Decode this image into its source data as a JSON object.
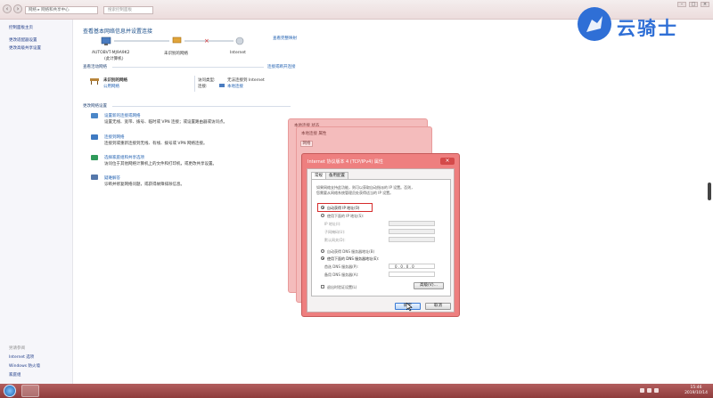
{
  "address": {
    "crumb1": "网络",
    "crumb2": "网络和共享中心"
  },
  "search": {
    "placeholder": "搜索控制面板"
  },
  "sidebar": {
    "items": [
      "控制面板主页",
      "更改适配器设置",
      "更改高级共享设置"
    ],
    "see_also_title": "另请参阅",
    "see_also": [
      "Internet 选项",
      "Windows 防火墙",
      "家庭组"
    ]
  },
  "main": {
    "title": "查看基本网络信息并设置连接",
    "view_full_map": "查看完整映射",
    "map": {
      "computer": "AUTOBVT-MJ9A9K2",
      "computer_sub": "(此计算机)",
      "network": "未识别的网络",
      "internet": "Internet"
    },
    "active_title": "查看活动网络",
    "connect_disconnect": "连接或断开连接",
    "network_name": "未识别的网络",
    "network_type": "公用网络",
    "access_type_label": "访问类型:",
    "access_type_value": "无法连接到 Internet",
    "connections_label": "连接:",
    "connections_value": "本地连接",
    "change_title": "更改网络设置",
    "tasks": [
      {
        "link": "设置新的连接或网络",
        "desc": "设置无线、宽带、拨号、临时或 VPN 连接；或设置路由器或访问点。"
      },
      {
        "link": "连接到网络",
        "desc": "连接到或重新连接到无线、有线、拨号或 VPN 网络连接。"
      },
      {
        "link": "选择家庭组和共享选项",
        "desc": "访问位于其他网络计算机上的文件和打印机，或更改共享设置。"
      },
      {
        "link": "疑难解答",
        "desc": "诊断并修复网络问题，或获得故障排除信息。"
      }
    ]
  },
  "bg_windows": {
    "status_title": "本地连接 状态",
    "props_title": "本地连接 属性",
    "tab": "网络"
  },
  "dialog": {
    "title": "Internet 协议版本 4 (TCP/IPv4) 属性",
    "tabs": [
      "常规",
      "备用配置"
    ],
    "desc1": "如果网络支持此功能，则可以获取自动指派的 IP 设置。否则，",
    "desc2": "您需要从网络系统管理员处获得适当的 IP 设置。",
    "auto_ip": "自动获得 IP 地址(O)",
    "manual_ip": "使用下面的 IP 地址(S):",
    "ip_label": "IP 地址(I):",
    "mask_label": "子网掩码(U):",
    "gateway_label": "默认网关(D):",
    "auto_dns": "自动获得 DNS 服务器地址(B)",
    "manual_dns": "使用下面的 DNS 服务器地址(E):",
    "pref_dns": "首选 DNS 服务器(P):",
    "pref_dns_value": "0  .  0  .  0  .  0",
    "alt_dns": "备用 DNS 服务器(A):",
    "validate": "退出时验证设置(L)",
    "advanced": "高级(V)...",
    "ok": "确定",
    "cancel": "取消"
  },
  "taskbar": {
    "time": "15:46",
    "date": "2019/10/14"
  },
  "watermark": {
    "text": "云骑士"
  },
  "colors": {
    "accent": "#1f5fb0",
    "highlight": "#d62c2c",
    "dialog_frame": "#ee7f7f",
    "taskbar": "#9e4848"
  }
}
